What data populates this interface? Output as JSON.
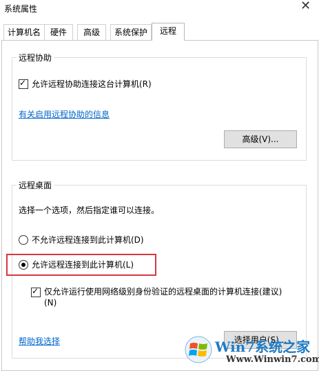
{
  "window": {
    "title": "系统属性",
    "close_glyph": "✕"
  },
  "tabs": [
    {
      "label": "计算机名",
      "active": false
    },
    {
      "label": "硬件",
      "active": false
    },
    {
      "label": "高级",
      "active": false
    },
    {
      "label": "系统保护",
      "active": false
    },
    {
      "label": "远程",
      "active": true
    }
  ],
  "remote_assistance": {
    "legend": "远程协助",
    "allow_checkbox": {
      "label": "允许远程协助连接这台计算机(R)",
      "checked": true
    },
    "info_link": "有关启用远程协助的信息",
    "advanced_button": "高级(V)..."
  },
  "remote_desktop": {
    "legend": "远程桌面",
    "description": "选择一个选项，然后指定谁可以连接。",
    "radio_disallow": {
      "label": "不允许远程连接到此计算机(D)",
      "selected": false
    },
    "radio_allow": {
      "label": "允许远程连接到此计算机(L)",
      "selected": true
    },
    "nla_checkbox": {
      "label_line1": "仅允许运行使用网络级别身份验证的远程桌面的计算机连接(建议)",
      "label_line2": "(N)",
      "checked": true
    },
    "help_link": "帮助我选择",
    "select_users_button": "选择用户(S)..."
  },
  "highlight_color": "#d9363e",
  "watermark": {
    "line1": "Win7系统之家",
    "line2": "Www.Winwin7.com"
  }
}
